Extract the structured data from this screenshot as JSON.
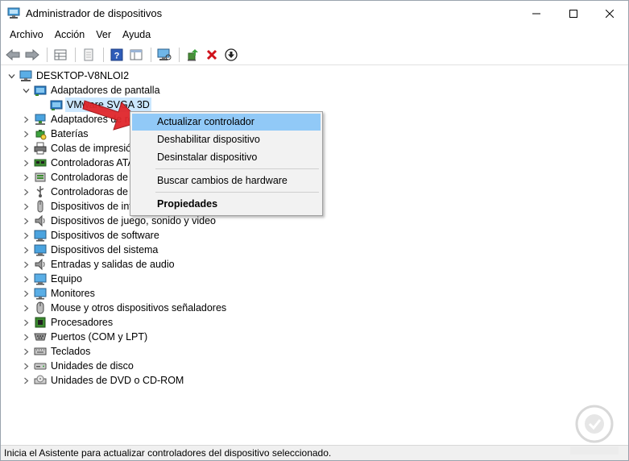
{
  "window": {
    "title": "Administrador de dispositivos"
  },
  "menu": {
    "items": [
      "Archivo",
      "Acción",
      "Ver",
      "Ayuda"
    ]
  },
  "toolbar": {
    "icons": [
      "back-arrow-icon",
      "forward-arrow-icon",
      "properties-grid-icon",
      "blank-page-icon",
      "help-icon",
      "view-panel-icon",
      "monitor-scan-icon",
      "update-driver-icon",
      "uninstall-x-icon",
      "disable-download-icon"
    ]
  },
  "tree": {
    "root": "DESKTOP-V8NLOI2",
    "expanded_category": "Adaptadores de pantalla",
    "selected_device": "VMware SVGA 3D",
    "categories": [
      "Adaptadores de red",
      "Baterías",
      "Colas de impresión",
      "Controladoras ATA/ATAPI IDE",
      "Controladoras de almacenamiento",
      "Controladoras de bus serie universal",
      "Dispositivos de interfaz de usuario (HID)",
      "Dispositivos de juego, sonido y video",
      "Dispositivos de software",
      "Dispositivos del sistema",
      "Entradas y salidas de audio",
      "Equipo",
      "Monitores",
      "Mouse y otros dispositivos señaladores",
      "Procesadores",
      "Puertos (COM y LPT)",
      "Teclados",
      "Unidades de disco",
      "Unidades de DVD o CD-ROM"
    ],
    "visible_labels": [
      "Adaptadores de re",
      "Baterías",
      "Colas de impresió",
      "Controladoras ATA",
      "Controladoras de",
      "Controladoras de",
      "Dispositivos de int",
      "Dispositivos de juego, sonido y video",
      "Dispositivos de software",
      "Dispositivos del sistema",
      "Entradas y salidas de audio",
      "Equipo",
      "Monitores",
      "Mouse y otros dispositivos señaladores",
      "Procesadores",
      "Puertos (COM y LPT)",
      "Teclados",
      "Unidades de disco",
      "Unidades de DVD o CD-ROM"
    ]
  },
  "context_menu": {
    "update": "Actualizar controlador",
    "disable": "Deshabilitar dispositivo",
    "uninstall": "Desinstalar dispositivo",
    "scan": "Buscar cambios de hardware",
    "properties": "Propiedades"
  },
  "status": {
    "text": "Inicia el Asistente para actualizar controladores del dispositivo seleccionado."
  },
  "colors": {
    "highlight": "#91c9f7",
    "selection": "#cce8ff",
    "arrow": "#e0272c"
  }
}
